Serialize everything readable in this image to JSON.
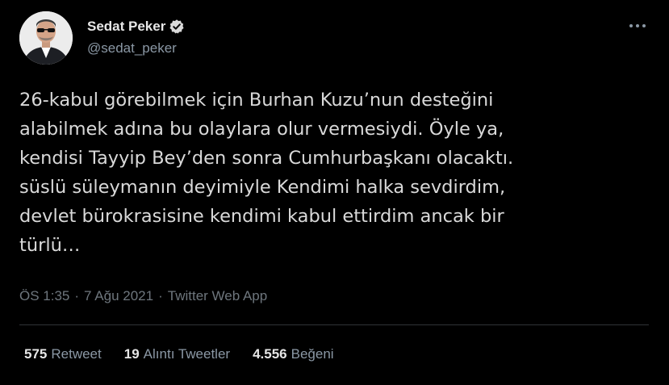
{
  "author": {
    "display_name": "Sedat Peker",
    "handle": "@sedat_peker",
    "verified": true,
    "verified_icon": "verified-badge-icon"
  },
  "more_icon": "more-options-icon",
  "tweet": {
    "text": "26-kabul görebilmek için Burhan Kuzu’nun desteğini\nalabilmek adına bu olaylara olur vermesiydi. Öyle ya,\nkendisi Tayyip Bey’den sonra Cumhurbaşkanı olacaktı.\nsüslü süleymanın deyimiyle Kendimi halka sevdirdim,\ndevlet bürokrasisine kendimi kabul ettirdim ancak bir\ntürlü…",
    "time": "ÖS 1:35",
    "sep1": "·",
    "date": "7 Ağu 2021",
    "sep2": "·",
    "source": "Twitter Web App"
  },
  "stats": {
    "retweets_count": "575",
    "retweets_label": "Retweet",
    "quotes_count": "19",
    "quotes_label": "Alıntı Tweetler",
    "likes_count": "4.556",
    "likes_label": "Beğeni"
  },
  "colors": {
    "background": "#000000",
    "text": "#d9d9d9",
    "secondary": "#8b98a5",
    "divider": "#2f3336"
  }
}
